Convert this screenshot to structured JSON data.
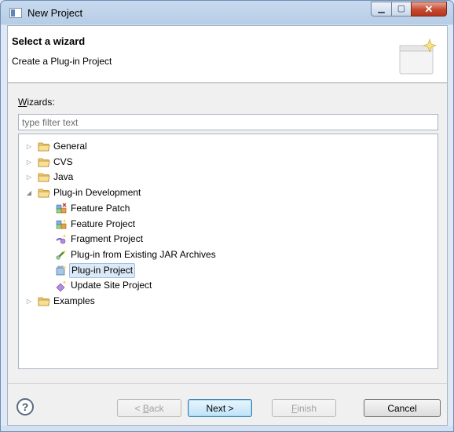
{
  "window": {
    "title": "New Project"
  },
  "header": {
    "title": "Select a wizard",
    "description": "Create a Plug-in Project"
  },
  "wizards": {
    "label_mnemonic": "W",
    "label_rest": "izards:",
    "filter_placeholder": "type filter text"
  },
  "tree": {
    "items": [
      {
        "label": "General",
        "icon": "folder-icon",
        "level": 0,
        "expanded": false
      },
      {
        "label": "CVS",
        "icon": "folder-icon",
        "level": 0,
        "expanded": false
      },
      {
        "label": "Java",
        "icon": "folder-icon",
        "level": 0,
        "expanded": false
      },
      {
        "label": "Plug-in Development",
        "icon": "folder-icon",
        "level": 0,
        "expanded": true
      },
      {
        "label": "Feature Patch",
        "icon": "feature-patch-icon",
        "level": 1
      },
      {
        "label": "Feature Project",
        "icon": "feature-project-icon",
        "level": 1
      },
      {
        "label": "Fragment Project",
        "icon": "fragment-project-icon",
        "level": 1
      },
      {
        "label": "Plug-in from Existing JAR Archives",
        "icon": "plugin-jar-icon",
        "level": 1
      },
      {
        "label": "Plug-in Project",
        "icon": "plugin-project-icon",
        "level": 1,
        "selected": true
      },
      {
        "label": "Update Site Project",
        "icon": "update-site-icon",
        "level": 1
      },
      {
        "label": "Examples",
        "icon": "folder-icon",
        "level": 0,
        "expanded": false
      }
    ]
  },
  "buttons": {
    "back_mnemonic": "B",
    "back_rest": "ack",
    "back_prefix": "< ",
    "next": "Next >",
    "finish_mnemonic": "F",
    "finish_rest": "inish",
    "cancel": "Cancel"
  },
  "colors": {
    "selection": "#dceaf8",
    "folder": "#e8b84a",
    "close": "#c54a30"
  }
}
